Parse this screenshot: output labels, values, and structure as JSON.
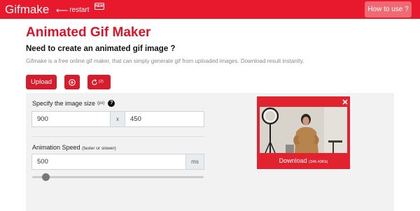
{
  "navbar": {
    "brand": "Gifmake",
    "restart_label": "restart",
    "badge": "NEW",
    "howto_label": "How to use ?"
  },
  "hero": {
    "title": "Animated Gif Maker",
    "subtitle": "Need to create an animated gif image ?",
    "description": "Gifmake is a free online gif maker, that can simply generate gif from uploaded images. Download result instantly."
  },
  "toolbar": {
    "upload_label": "Upload",
    "add_icon": "plus-circle-icon",
    "refresh_icon": "refresh-icon",
    "refresh_count": "(2)"
  },
  "settings": {
    "size_label": "Specify the image size",
    "size_unit": "(px)",
    "help_icon": "question-circle-icon",
    "help_glyph": "?",
    "width_value": "900",
    "separator": "x",
    "height_value": "450",
    "speed_label": "Animation Speed",
    "speed_hint": "(faster or slower)",
    "speed_value": "500",
    "speed_unit": "ms",
    "speed_slider_fraction": 0.06
  },
  "preview": {
    "close_icon": "close-icon",
    "download_label": "Download",
    "download_size": "(346.43Kb)"
  },
  "colors": {
    "brand_red": "#e8192c",
    "button_red": "#d51d2d",
    "title_red": "#d9142a",
    "panel_gray": "#f2f2f2"
  }
}
